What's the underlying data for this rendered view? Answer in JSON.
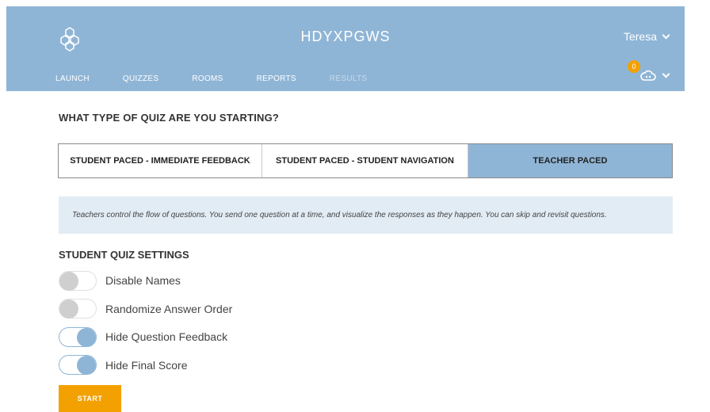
{
  "app": {
    "title": "HDYXPGWS"
  },
  "user": {
    "name": "Teresa"
  },
  "nav": {
    "items": [
      {
        "label": "LAUNCH",
        "disabled": false
      },
      {
        "label": "QUIZZES",
        "disabled": false
      },
      {
        "label": "ROOMS",
        "disabled": false
      },
      {
        "label": "REPORTS",
        "disabled": false
      },
      {
        "label": "RESULTS",
        "disabled": true
      }
    ]
  },
  "notifications": {
    "count": "0"
  },
  "quiz_type": {
    "heading": "WHAT TYPE OF QUIZ ARE YOU STARTING?",
    "tabs": [
      {
        "label": "STUDENT PACED - IMMEDIATE FEEDBACK",
        "selected": false
      },
      {
        "label": "STUDENT PACED - STUDENT NAVIGATION",
        "selected": false
      },
      {
        "label": "TEACHER PACED",
        "selected": true
      }
    ],
    "description": "Teachers control the flow of questions. You send one question at a time, and visualize the responses as they happen. You can skip and revisit questions."
  },
  "settings": {
    "title": "STUDENT QUIZ SETTINGS",
    "items": [
      {
        "label": "Disable Names",
        "on": false
      },
      {
        "label": "Randomize Answer Order",
        "on": false
      },
      {
        "label": "Hide Question Feedback",
        "on": true
      },
      {
        "label": "Hide Final Score",
        "on": true
      }
    ]
  },
  "actions": {
    "start_label": "START"
  },
  "colors": {
    "primary": "#8fb5d6",
    "accent": "#f3a100",
    "info_bg": "#e2ecf4"
  }
}
